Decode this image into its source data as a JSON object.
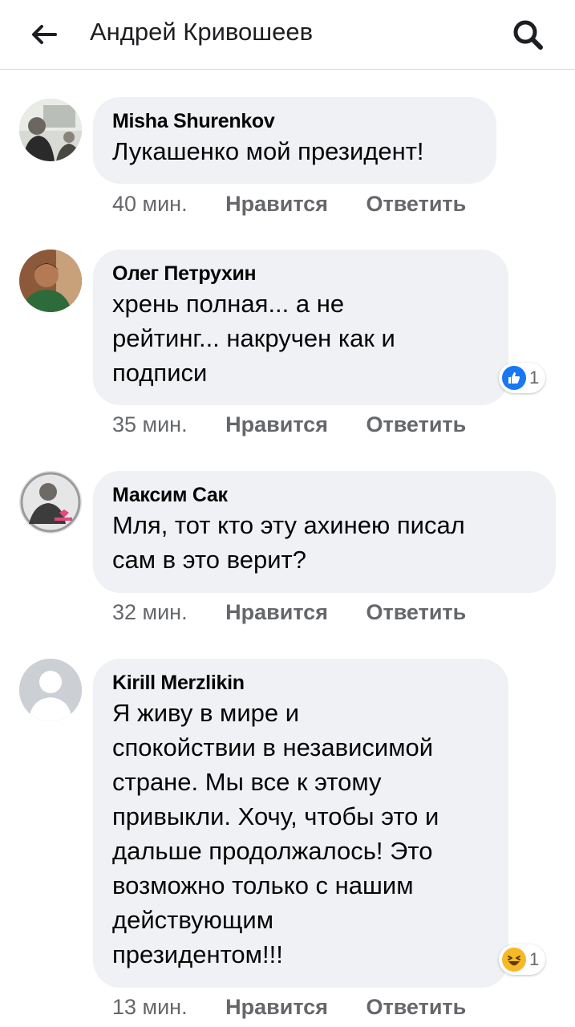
{
  "header": {
    "title": "Андрей Кривошеев"
  },
  "comments": [
    {
      "author": "Misha Shurenkov",
      "text": "Лукашенко мой президент!",
      "time": "40 мин.",
      "like_label": "Нравится",
      "reply_label": "Ответить"
    },
    {
      "author": "Олег Петрухин",
      "text_lines": [
        "хрень полная... а не",
        "рейтинг... накручен как и",
        "подписи"
      ],
      "time": "35 мин.",
      "like_label": "Нравится",
      "reply_label": "Ответить",
      "reaction": {
        "icon": "like-icon",
        "count": "1"
      }
    },
    {
      "author": "Максим Сак",
      "text_lines": [
        "Мля, тот кто эту ахинею писал",
        "сам в это верит?"
      ],
      "time": "32 мин.",
      "like_label": "Нравится",
      "reply_label": "Ответить"
    },
    {
      "author": "Kirill Merzlikin",
      "text_lines": [
        "Я живу в мире и",
        "спокойствии в независимой",
        "стране. Мы все к этому",
        "привыкли. Хочу, чтобы это и",
        "дальше продолжалось! Это",
        "возможно только с нашим",
        "действующим",
        "президентом!!!"
      ],
      "time": "13 мин.",
      "like_label": "Нравится",
      "reply_label": "Ответить",
      "reaction": {
        "icon": "haha-icon",
        "count": "1"
      }
    }
  ],
  "colors": {
    "bubble": "#eff1f4",
    "meta": "#65676b",
    "like_blue": "#1877f2",
    "haha_yellow": "#f7b928"
  }
}
